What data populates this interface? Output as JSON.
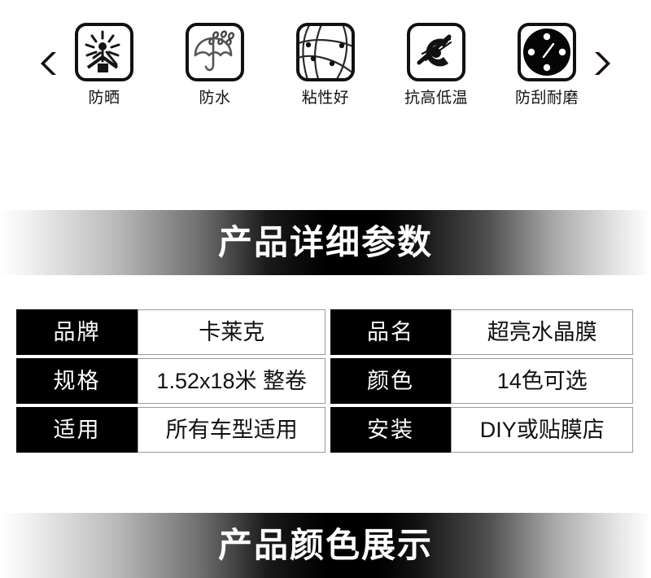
{
  "features": {
    "prev_arrow": "prev",
    "next_arrow": "next",
    "items": [
      {
        "label": "防晒",
        "icon": "sun-house-icon"
      },
      {
        "label": "防水",
        "icon": "umbrella-rain-icon"
      },
      {
        "label": "粘性好",
        "icon": "mesh-web-icon"
      },
      {
        "label": "抗高低温",
        "icon": "thermal-swirl-icon"
      },
      {
        "label": "防刮耐磨",
        "icon": "dial-disc-icon"
      }
    ]
  },
  "banners": {
    "params_title": "产品详细参数",
    "colors_title": "产品颜色展示"
  },
  "spec_table": {
    "rows": [
      {
        "label_left": "品牌",
        "value_left": "卡莱克",
        "label_right": "品名",
        "value_right": "超亮水晶膜"
      },
      {
        "label_left": "规格",
        "value_left": "1.52x18米 整卷",
        "label_right": "颜色",
        "value_right": "14色可选"
      },
      {
        "label_left": "适用",
        "value_left": "所有车型适用",
        "label_right": "安装",
        "value_right": "DIY或贴膜店"
      }
    ]
  },
  "colors": {
    "label_bg": "#000000",
    "label_fg": "#ffffff",
    "value_bg": "#ffffff",
    "value_fg": "#111111",
    "banner_dark": "#000000",
    "banner_light": "#ffffff",
    "icon_stroke": "#111111"
  }
}
